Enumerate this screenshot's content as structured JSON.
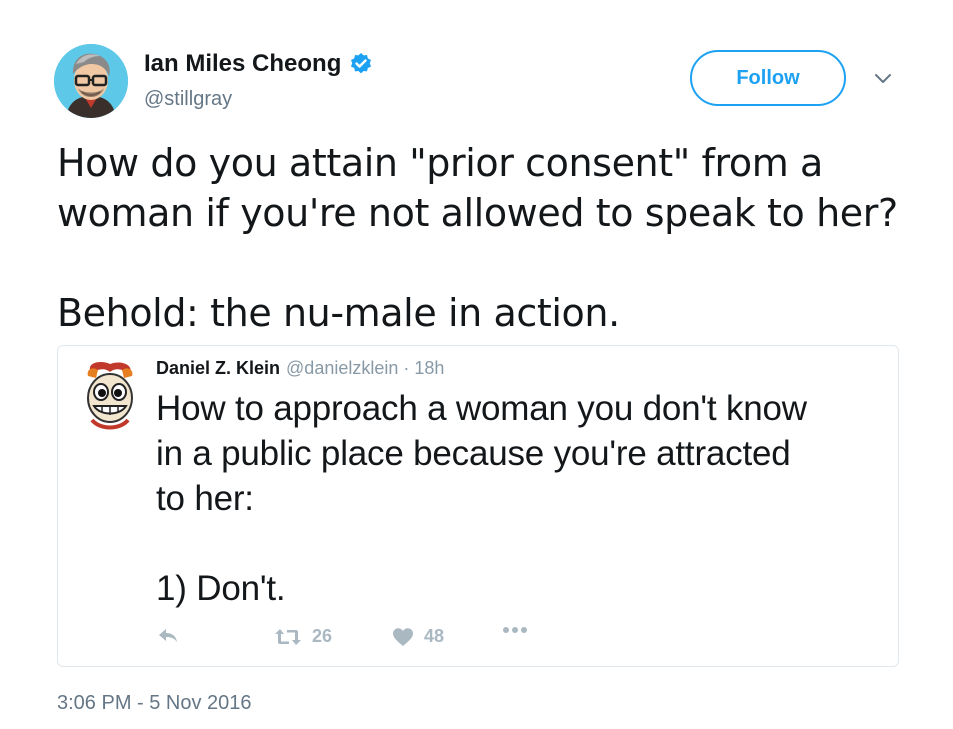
{
  "author": {
    "display_name": "Ian Miles Cheong",
    "handle": "@stillgray",
    "verified": true
  },
  "follow_button": {
    "label": "Follow"
  },
  "tweet": {
    "text": "How do you attain \"prior consent\" from a\nwoman if you're not allowed to speak to her?\n\nBehold: the nu-male in action.",
    "timestamp": "3:06 PM - 5 Nov 2016"
  },
  "quoted_tweet": {
    "display_name": "Daniel Z. Klein",
    "handle": "@danielzklein",
    "separator": "·",
    "time": "18h",
    "text": "How to approach a woman you don't know\nin a public place because you're attracted\nto her:\n\n1) Don't.",
    "retweet_count": "26",
    "like_count": "48"
  },
  "icons": {
    "verified": "verified-badge-icon",
    "caret": "chevron-down-icon",
    "reply": "reply-icon",
    "retweet": "retweet-icon",
    "like": "heart-icon",
    "more": "more-dots-icon"
  },
  "colors": {
    "accent": "#1da1f2",
    "text": "#14171a",
    "muted": "#657786",
    "action_icons": "#aab8c2",
    "border": "#e1e8ed"
  }
}
